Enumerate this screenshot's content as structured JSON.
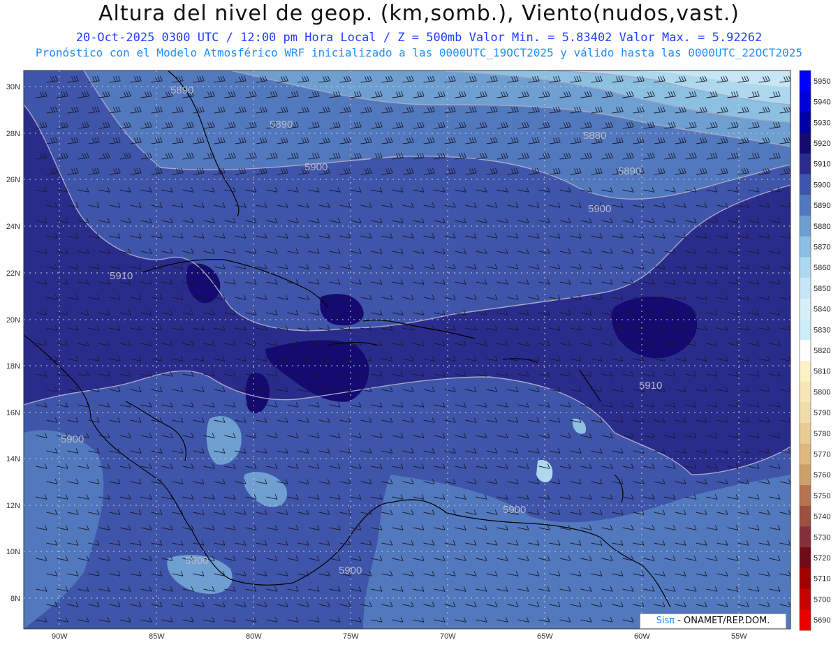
{
  "header": {
    "title": "Altura del nivel de geop. (km,somb.), Viento(nudos,vast.)",
    "line1": "20-Oct-2025  0300 UTC / 12:00 pm Hora Local / Z = 500mb    Valor Min. = 5.83402  Valor Max. = 5.92262",
    "line2": "Pronóstico con el Modelo Atmosférico WRF inicializado a las 0000UTC_19OCT2025 y válido hasta las  0000UTC_22OCT2025"
  },
  "map": {
    "lon_labels": [
      "90W",
      "85W",
      "80W",
      "75W",
      "70W",
      "65W",
      "60W",
      "55W"
    ],
    "lat_labels": [
      "30N",
      "28N",
      "26N",
      "24N",
      "22N",
      "20N",
      "18N",
      "16N",
      "14N",
      "12N",
      "10N",
      "8N"
    ],
    "contour_labels": [
      "5890",
      "5890",
      "5900",
      "5880",
      "5890",
      "5900",
      "5910",
      "5910",
      "5900",
      "5900",
      "5900",
      "5900"
    ]
  },
  "colorbar": {
    "levels": [
      "5950",
      "5940",
      "5930",
      "5920",
      "5910",
      "5900",
      "5890",
      "5880",
      "5870",
      "5860",
      "5850",
      "5840",
      "5830",
      "5820",
      "5810",
      "5800",
      "5790",
      "5780",
      "5770",
      "5760",
      "5750",
      "5740",
      "5730",
      "5720",
      "5710",
      "5700",
      "5690"
    ],
    "colors": [
      "#0000ff",
      "#0000d8",
      "#0000a8",
      "#140a70",
      "#2a2c8c",
      "#3f55aa",
      "#5279bd",
      "#6e9fd0",
      "#8cc0e0",
      "#aed8ee",
      "#c6e6f5",
      "#d8eff9",
      "#cceef6",
      "#ffffff",
      "#fbf2c8",
      "#f6e6b8",
      "#f0dcaa",
      "#e8cc96",
      "#dcb880",
      "#cca06a",
      "#b47650",
      "#9c5040",
      "#84303a",
      "#700c18",
      "#a00000",
      "#c80000",
      "#e80000"
    ]
  },
  "credit": {
    "sis": "Sisπ",
    "org": " - ONAMET/REP.DOM."
  }
}
